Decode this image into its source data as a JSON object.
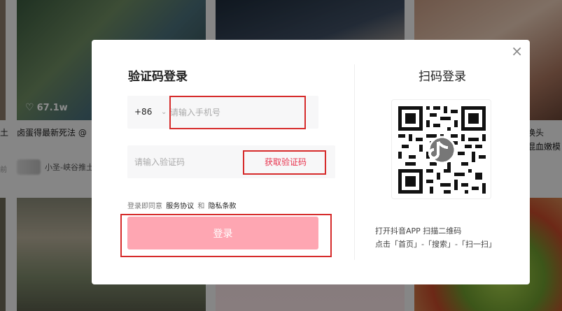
{
  "feed": {
    "likes": "67.1w",
    "caption_left": "卤蛋得最新死法 @",
    "author_name": "小圣-峡谷推土",
    "caption_right_1": "换头",
    "caption_right_2": "混血嫩模",
    "stray_left": "土",
    "stray_left2": "前"
  },
  "dialog": {
    "close": "×",
    "login_title": "验证码登录",
    "country_code": "+86",
    "country_arrow": "⌄",
    "phone_placeholder": "请输入手机号",
    "code_placeholder": "请输入验证码",
    "get_code": "获取验证码",
    "agree_prefix": "登录即同意",
    "service_terms": "服务协议",
    "and": "和",
    "privacy_terms": "隐私条款",
    "login_button": "登录",
    "qr_title": "扫码登录",
    "qr_tip1": "打开抖音APP 扫描二维码",
    "qr_tip2": "点击「首页」-「搜索」-「扫一扫」"
  },
  "colors": {
    "accent": "#e8344e",
    "login_button": "#fea6b2",
    "highlight": "#d62b2b"
  }
}
